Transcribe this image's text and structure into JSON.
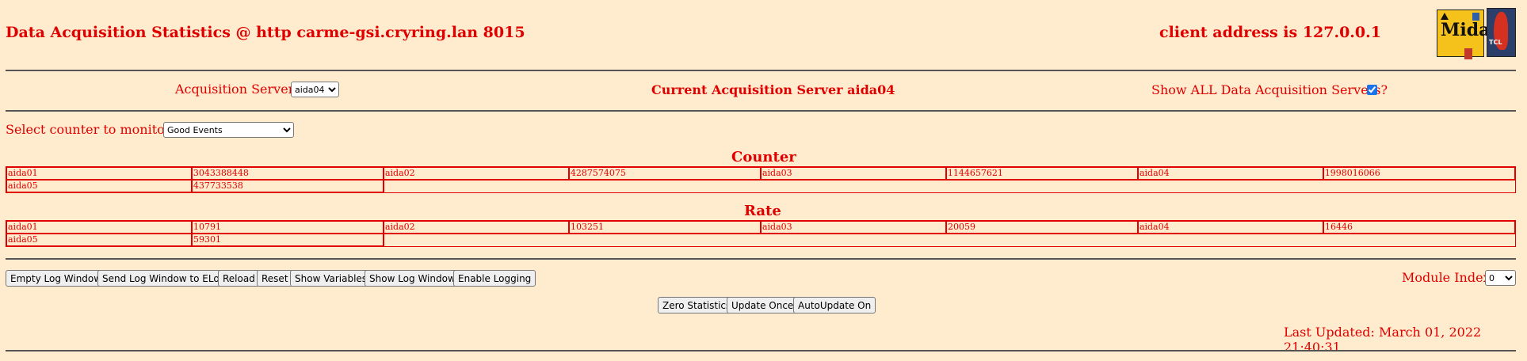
{
  "header": {
    "title": "Data Acquisition Statistics @ http carme-gsi.cryring.lan 8015",
    "client_address": "client address is 127.0.0.1",
    "midas_logo_text": "Midas",
    "tcl_logo_text": "TCL"
  },
  "server_bar": {
    "acq_servers_label": "Acquisition Servers",
    "acq_servers_selected": "aida04",
    "current_server_text": "Current Acquisition Server aida04",
    "show_all_label": "Show ALL Data Acquisition Servers?",
    "show_all_checked": true
  },
  "counter_select": {
    "label": "Select counter to monitor",
    "selected": "Good Events"
  },
  "counter_table": {
    "title": "Counter",
    "rows": [
      [
        [
          "aida01",
          "3043388448"
        ],
        [
          "aida02",
          "4287574075"
        ],
        [
          "aida03",
          "1144657621"
        ],
        [
          "aida04",
          "1998016066"
        ]
      ],
      [
        [
          "aida05",
          "437733538"
        ]
      ]
    ]
  },
  "rate_table": {
    "title": "Rate",
    "rows": [
      [
        [
          "aida01",
          "10791"
        ],
        [
          "aida02",
          "103251"
        ],
        [
          "aida03",
          "20059"
        ],
        [
          "aida04",
          "16446"
        ]
      ],
      [
        [
          "aida05",
          "59301"
        ]
      ]
    ]
  },
  "buttons": {
    "empty_log": "Empty Log Window",
    "send_elog": "Send Log Window to ELog",
    "reload": "Reload",
    "reset": "Reset",
    "show_variables": "Show Variables",
    "show_log": "Show Log Window",
    "enable_logging": "Enable Logging",
    "zero_stats": "Zero Statistics",
    "update_once": "Update Once",
    "autoupdate": "AutoUpdate On"
  },
  "module_index": {
    "label": "Module Index",
    "selected": "0"
  },
  "last_updated": "Last Updated: March 01, 2022 21:40:31"
}
